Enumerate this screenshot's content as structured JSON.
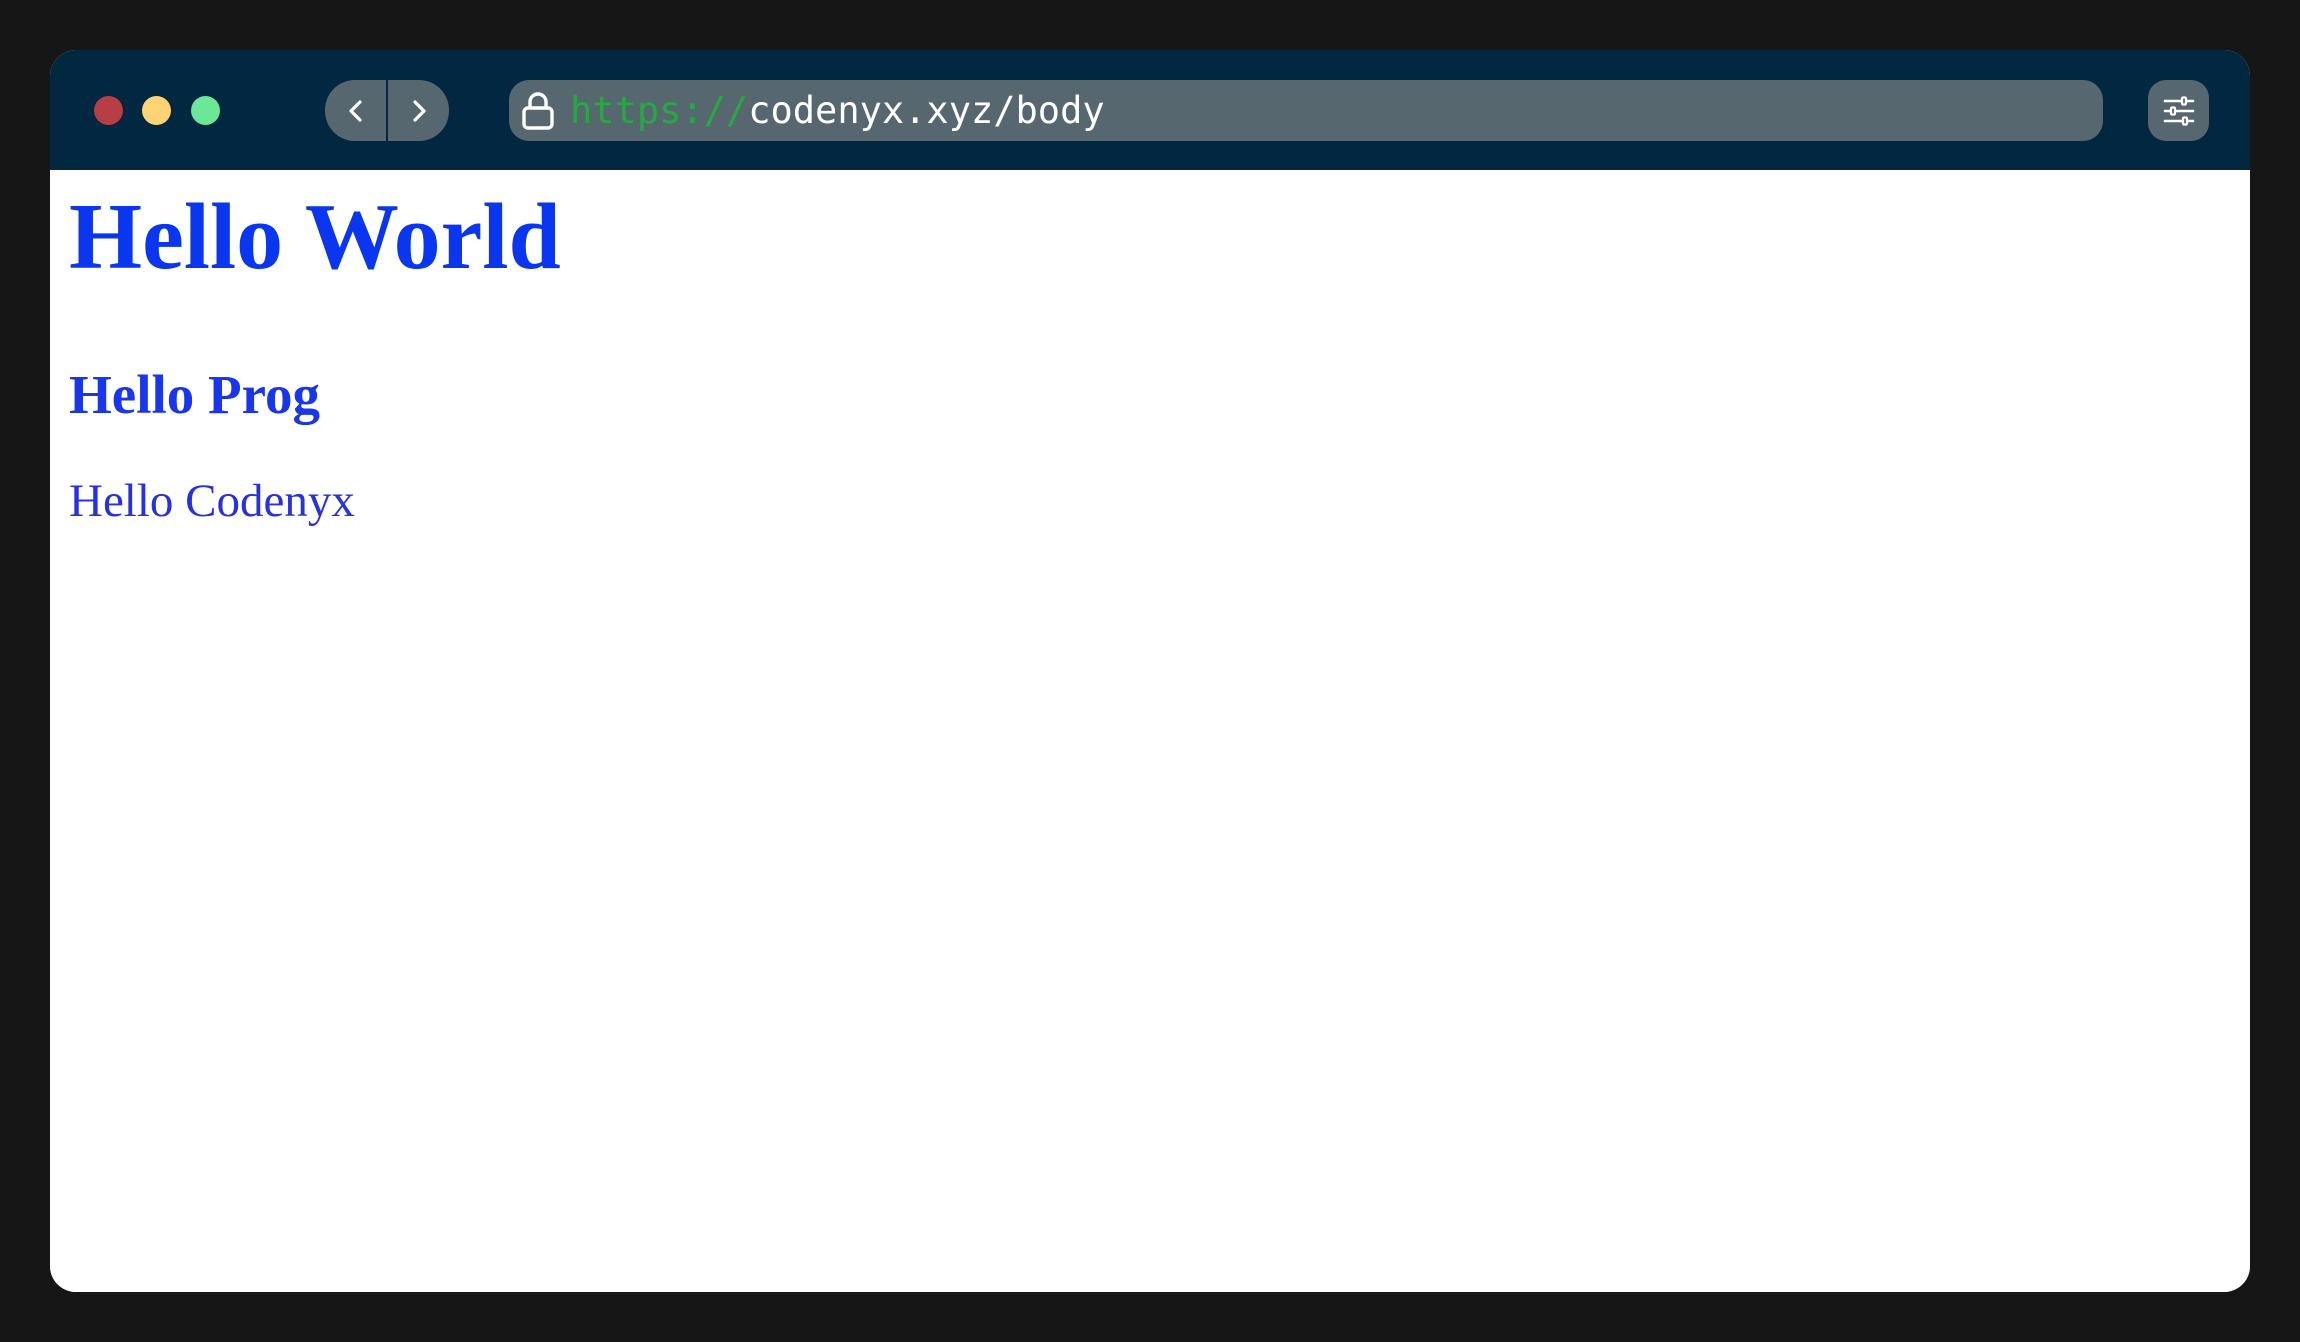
{
  "browser": {
    "url_scheme": "https://",
    "url_rest": "codenyx.xyz/body",
    "icons": {
      "back": "chevron-left-icon",
      "forward": "chevron-right-icon",
      "lock": "lock-icon",
      "settings": "sliders-icon"
    },
    "colors": {
      "titlebar": "#022741",
      "control": "#576770",
      "scheme": "#27a843",
      "close": "#b83e45",
      "minimize": "#fdd475",
      "maximize": "#6be797"
    }
  },
  "page": {
    "heading1": "Hello World",
    "heading2": "Hello Prog",
    "paragraph": "Hello Codenyx",
    "text_color": "#0a36f0"
  }
}
